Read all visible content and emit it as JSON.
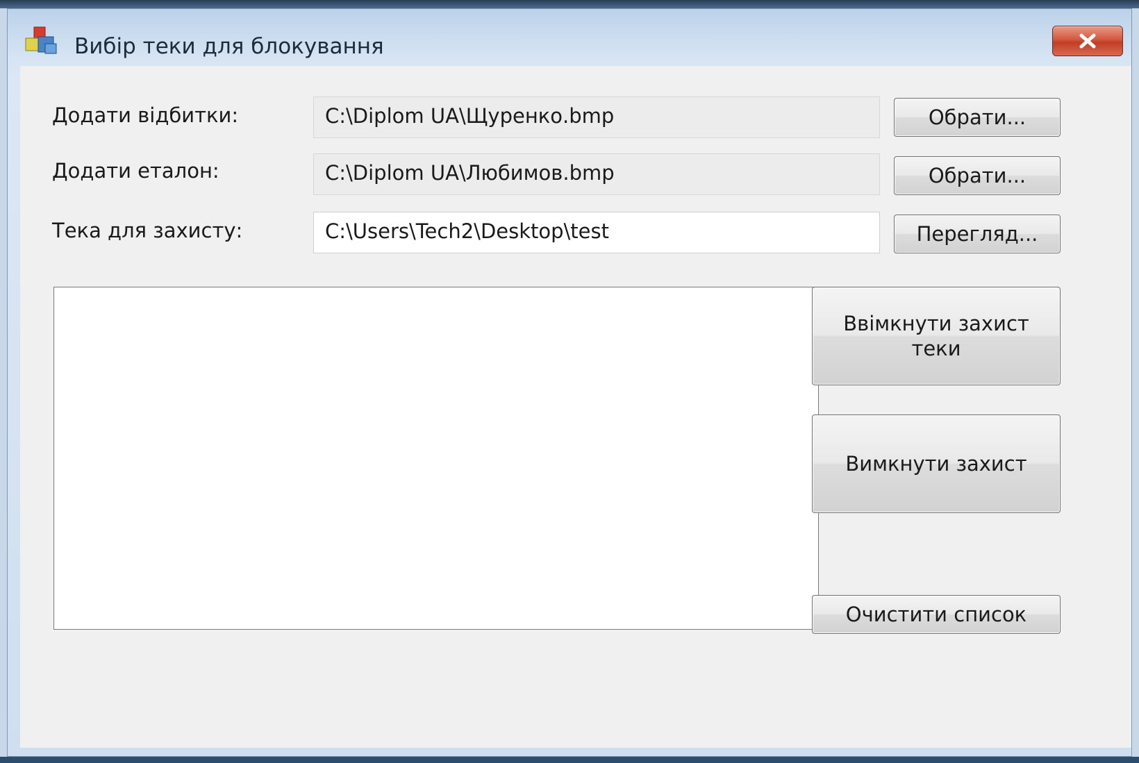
{
  "window": {
    "title": "Вибір теки для блокування"
  },
  "form": {
    "prints_label": "Додати відбитки:",
    "prints_value": "C:\\Diplom UA\\Щуренко.bmp",
    "prints_button": "Обрати...",
    "reference_label": "Додати еталон:",
    "reference_value": "C:\\Diplom UA\\Любимов.bmp",
    "reference_button": "Обрати...",
    "folder_label": "Тека для захисту:",
    "folder_value": "C:\\Users\\Tech2\\Desktop\\test",
    "folder_button": "Перегляд..."
  },
  "actions": {
    "enable_protection": "Ввімкнути захист теки",
    "disable_protection": "Вимкнути захист",
    "clear_list": "Очистити список"
  },
  "list": {
    "items": []
  },
  "icons": {
    "app": "app-blocks-icon",
    "close": "close-icon"
  },
  "colors": {
    "close_button": "#c9452d",
    "dialog_bg": "#f0f0f0"
  }
}
